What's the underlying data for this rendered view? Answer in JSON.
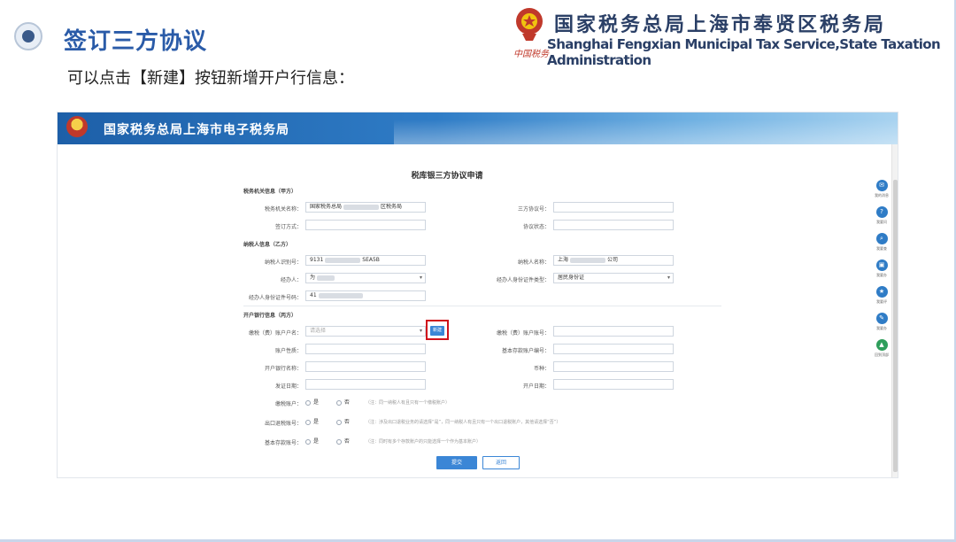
{
  "slide": {
    "title": "签订三方协议",
    "instruction": "可以点击【新建】按钮新增开户行信息：",
    "brand_cn": "国家税务总局上海市奉贤区税务局",
    "brand_en": "Shanghai Fengxian Municipal Tax Service,State Taxation  Administration",
    "emblem_text": "中国税务"
  },
  "app": {
    "header_title": "国家税务总局上海市电子税务局",
    "form_title": "税库银三方协议申请",
    "sections": {
      "tax_authority": "税务机关信息（甲方）",
      "taxpayer": "纳税人信息（乙方）",
      "bank": "开户银行信息（丙方）"
    },
    "fields": {
      "tax_office_label": "税务机关名称：",
      "tax_office_value_a": "国家税务总局",
      "tax_office_value_b": "区税务局",
      "sign_method_label": "签订方式：",
      "agreement_no_label": "三方协议号：",
      "agreement_status_label": "协议状态：",
      "taxpayer_id_label": "纳税人识别号：",
      "taxpayer_id_value_a": "9131",
      "taxpayer_id_value_b": "SEA5B",
      "taxpayer_name_label": "纳税人名称：",
      "taxpayer_name_value_a": "上海",
      "taxpayer_name_value_b": "公司",
      "handler_label": "经办人：",
      "handler_value": "为",
      "handler_id_type_label": "经办人身份证件类型：",
      "handler_id_type_value": "居民身份证",
      "handler_id_no_label": "经办人身份证件号码：",
      "handler_id_no_value": "41",
      "bank_account_name_label": "缴税（费）账户户名：",
      "bank_account_name_placeholder": "请选择",
      "bank_account_no_label": "缴税（费）账户账号：",
      "account_nature_label": "账户性质：",
      "basic_account_no_label": "基本存款账户编号：",
      "bank_name_label": "开户银行名称：",
      "currency_label": "币种：",
      "issue_date_label": "发证日期：",
      "open_date_label": "开户日期：",
      "tax_account_label": "缴税账户：",
      "export_refund_label": "出口退税账号：",
      "basic_deposit_label": "基本存款账号："
    },
    "radio": {
      "yes": "是",
      "no": "否"
    },
    "notes": {
      "tax_account": "（注：同一纳税人有且只有一个缴税账户）",
      "export_refund": "（注：涉及出口退税业务的请选择“是”，同一纳税人有且只有一个出口退税账户，其他请选择“否”）",
      "basic_deposit": "（注：同时有多个存款账户的只能选择一个作为基本账户）"
    },
    "buttons": {
      "new": "新建",
      "submit": "提交",
      "back": "返回"
    },
    "side_tools": [
      "我的消息",
      "我要问",
      "我要查",
      "我要办",
      "我要评",
      "我要办",
      "回到顶部"
    ]
  }
}
